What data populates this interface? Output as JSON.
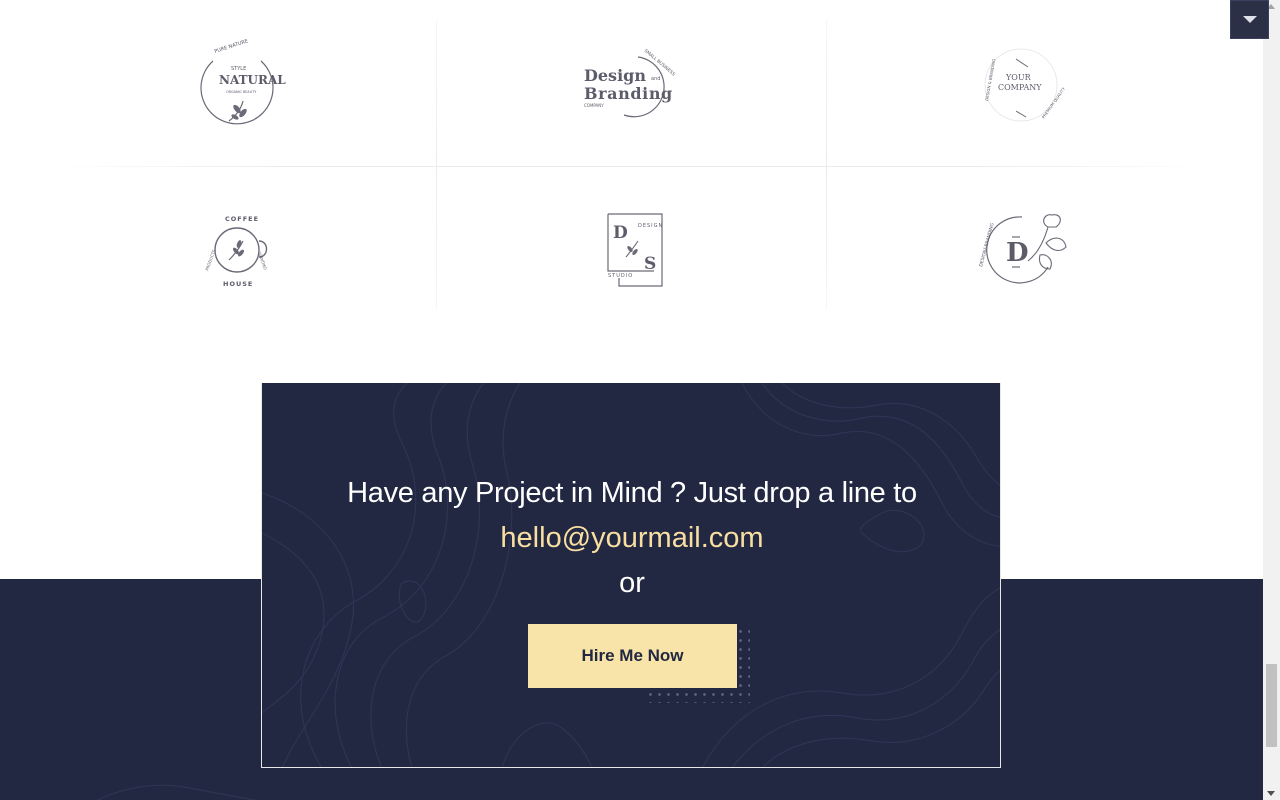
{
  "logos": [
    {
      "name": "natural",
      "lines": [
        "PURE NATURE",
        "STYLE",
        "NATURAL",
        "ORGANIC BEAUTY"
      ]
    },
    {
      "name": "design-branding",
      "lines": [
        "Design",
        "and",
        "Branding",
        "SMALL BUSINESS",
        "COMPANY"
      ]
    },
    {
      "name": "your-company",
      "lines": [
        "YOUR",
        "COMPANY",
        "DESIGN & BRANDING",
        "PREMIUM QUALITY"
      ]
    },
    {
      "name": "coffee-house",
      "lines": [
        "COFFEE",
        "HOUSE",
        "PRODUCTS",
        "ORGANIC"
      ]
    },
    {
      "name": "design-studio",
      "lines": [
        "D",
        "S",
        "DESIGN",
        "STUDIO"
      ]
    },
    {
      "name": "design-branding-d",
      "lines": [
        "D",
        "DESIGN&BRANDING"
      ]
    }
  ],
  "cta": {
    "title": "Have any Project in Mind ? Just drop a line to",
    "email": "hello@yourmail.com",
    "or": "or",
    "button_label": "Hire Me Now"
  },
  "colors": {
    "navy": "#222742",
    "accent": "#f8e4a8",
    "email": "#f8dfa1",
    "logo_ink": "#5c5c6a"
  },
  "icons": {
    "dropdown": "chevron-down-icon"
  }
}
